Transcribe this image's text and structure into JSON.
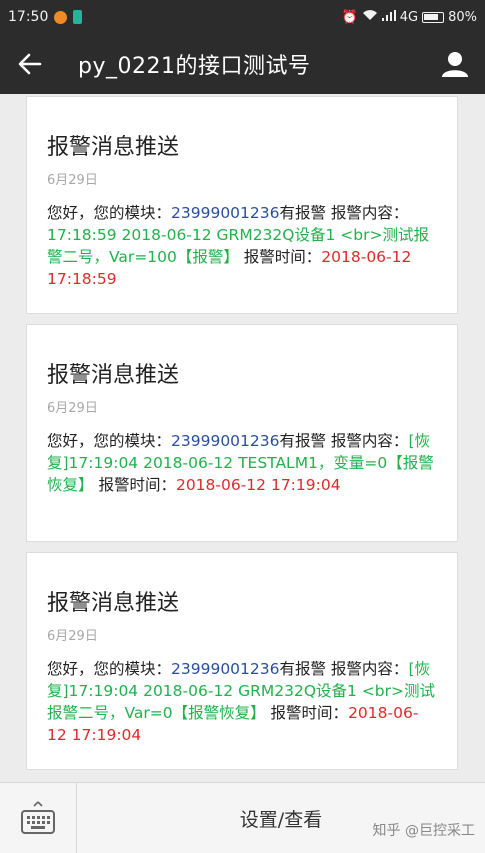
{
  "status_bar": {
    "time": "17:50",
    "network": "4G",
    "battery": "80%"
  },
  "header": {
    "title": "py_0221的接口测试号"
  },
  "messages": [
    {
      "title": "报警消息推送",
      "date": "6月29日",
      "s1": "您好，您的模块：",
      "s2": "23999001236",
      "s3": "有报警 报警内容：",
      "s4": "17:18:59 2018-06-12 GRM232Q设备1 <br>测试报警二号，Var=100【报警】",
      "s5": " 报警时间：",
      "s6": "2018-06-12 17:18:59"
    },
    {
      "title": "报警消息推送",
      "date": "6月29日",
      "s1": "您好，您的模块：",
      "s2": "23999001236",
      "s3": "有报警 报警内容：",
      "s4": "[恢复]17:19:04 2018-06-12 TESTALM1，变量=0【报警恢复】",
      "s5": " 报警时间：",
      "s6": "2018-06-12 17:19:04"
    },
    {
      "title": "报警消息推送",
      "date": "6月29日",
      "s1": "您好，您的模块：",
      "s2": "23999001236",
      "s3": "有报警 报警内容：",
      "s4": "[恢复]17:19:04 2018-06-12 GRM232Q设备1 <br>测试报警二号，Var=0【报警恢复】",
      "s5": " 报警时间：",
      "s6": "2018-06-12 17:19:04"
    }
  ],
  "bottom_bar": {
    "menu_label": "设置/查看"
  },
  "watermark": "知乎 @巨控采工",
  "colors": {
    "bar_bg": "#2c2c2c",
    "module_blue": "#2a4f9c",
    "content_green": "#22b14c",
    "time_red": "#e02a2a"
  },
  "icons": {
    "back": "arrow-left-icon",
    "profile": "person-icon",
    "keyboard": "keyboard-icon"
  }
}
